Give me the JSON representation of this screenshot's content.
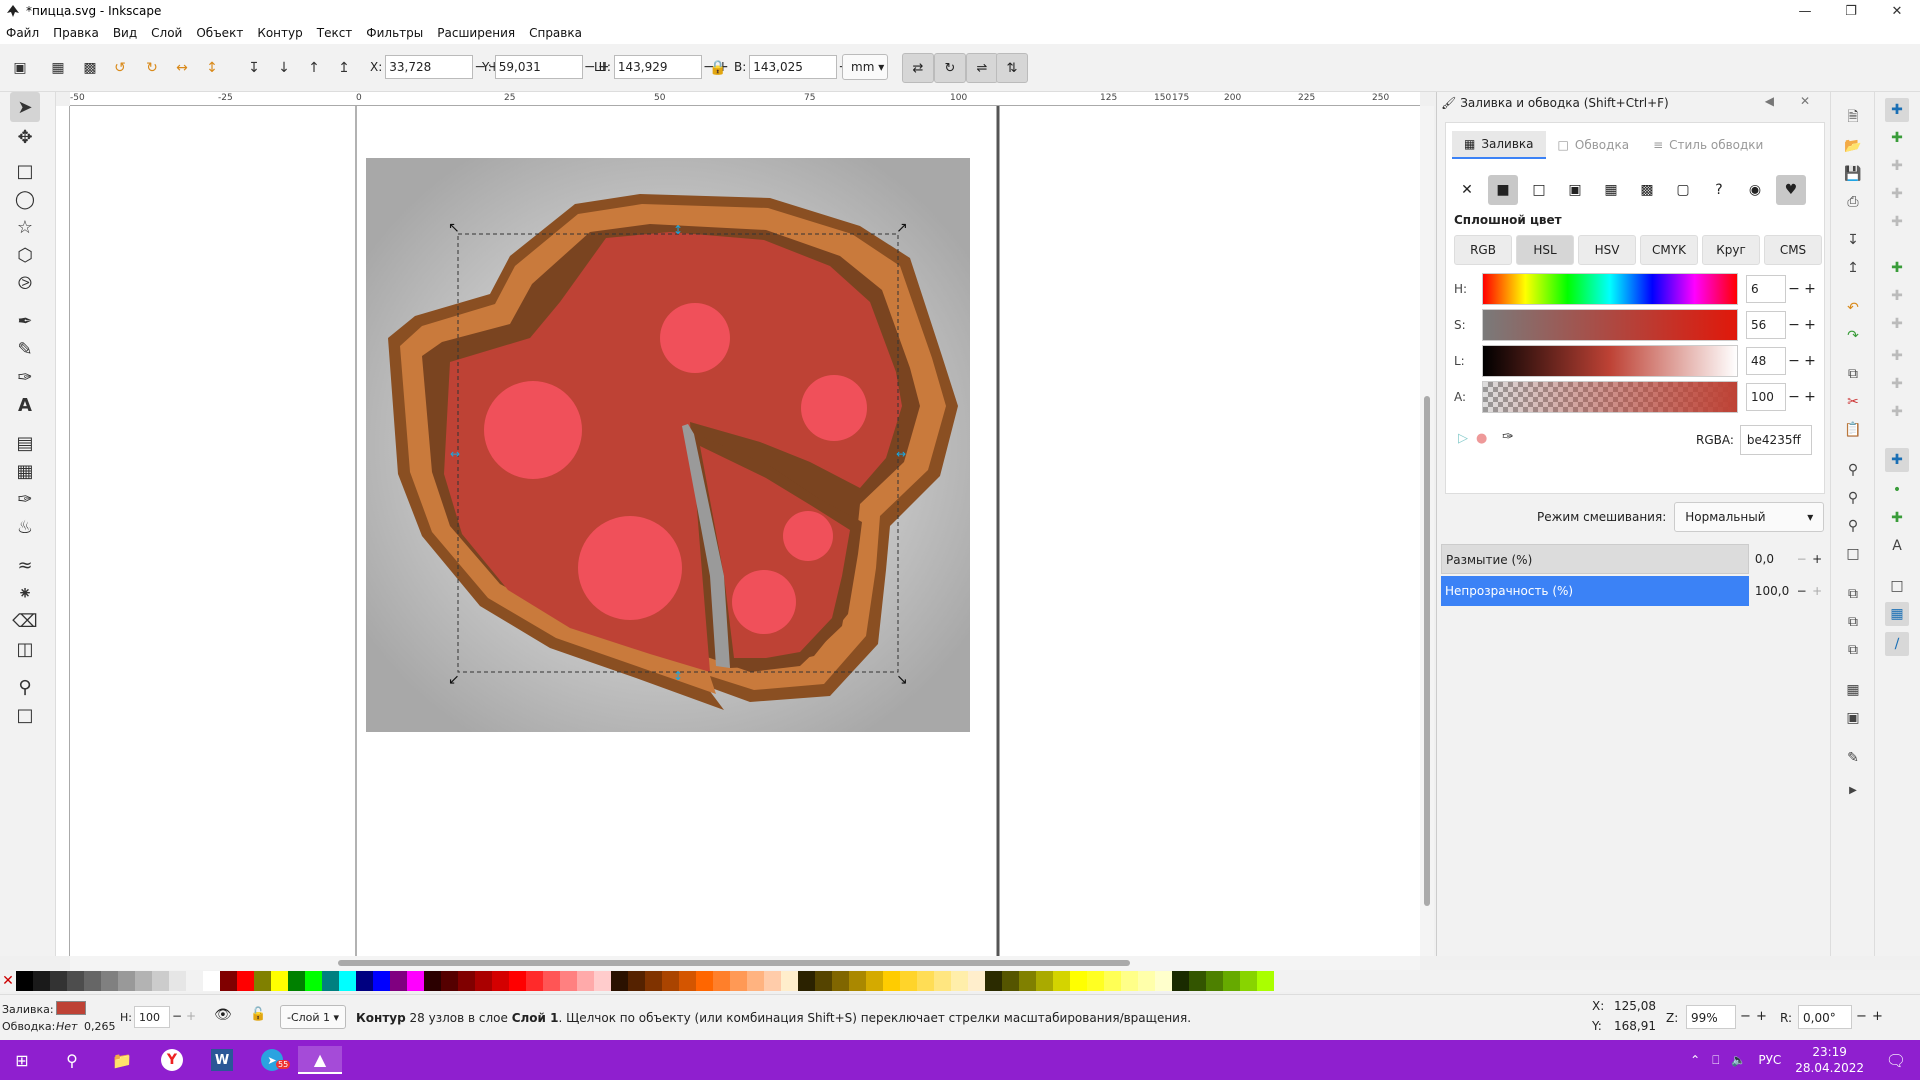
{
  "window": {
    "title": "*пицца.svg - Inkscape"
  },
  "menu": [
    "Файл",
    "Правка",
    "Вид",
    "Слой",
    "Объект",
    "Контур",
    "Текст",
    "Фильтры",
    "Расширения",
    "Справка"
  ],
  "toolbar": {
    "x_label": "X:",
    "x_value": "33,728",
    "y_label": "Y:",
    "y_value": "59,031",
    "w_label": "Ш:",
    "w_value": "143,929",
    "h_label": "В:",
    "h_value": "143,025",
    "unit": "mm"
  },
  "ruler": {
    "h_ticks": [
      "-50",
      "-25",
      "0",
      "25",
      "50",
      "75",
      "100",
      "125",
      "150",
      "175",
      "200",
      "225",
      "250"
    ]
  },
  "dock": {
    "title": "Заливка и обводка (Shift+Ctrl+F)",
    "tabs": [
      "Заливка",
      "Обводка",
      "Стиль обводки"
    ],
    "paint_type_label": "Сплошной цвет",
    "modes": [
      "RGB",
      "HSL",
      "HSV",
      "CMYK",
      "Круг",
      "CMS"
    ],
    "sliders": [
      {
        "label": "H:",
        "value": "6"
      },
      {
        "label": "S:",
        "value": "56"
      },
      {
        "label": "L:",
        "value": "48"
      },
      {
        "label": "A:",
        "value": "100"
      }
    ],
    "rgba_label": "RGBA:",
    "rgba_value": "be4235ff",
    "blend_label": "Режим смешивания:",
    "blend_value": "Нормальный",
    "blur_label": "Размытие (%)",
    "blur_value": "0,0",
    "opacity_label": "Непрозрачность (%)",
    "opacity_value": "100,0"
  },
  "status": {
    "fill_label": "Заливка:",
    "stroke_label": "Обводка:",
    "stroke_value": "Нет",
    "stroke_width": "0,265",
    "opacity_label": "Н:",
    "opacity_value": "100",
    "layer": "-Слой 1",
    "message_bold": "Контур",
    "message_mid": " 28 узлов в слое ",
    "message_layer": "Слой 1",
    "message_rest": ". Щелчок по объекту (или комбинация Shift+S) переключает стрелки масштабирования/вращения.",
    "x_label": "X:",
    "x_value": "125,08",
    "y_label": "Y:",
    "y_value": "168,91",
    "zoom_label": "Z:",
    "zoom_value": "99%",
    "rotate_label": "R:",
    "rotate_value": "0,00°"
  },
  "taskbar": {
    "time": "23:19",
    "date": "28.04.2022",
    "lang": "РУС",
    "badge": "55"
  },
  "colors": {
    "fill": "#be4235",
    "accent": "#3b82f6",
    "taskbar": "#8f1fcf"
  }
}
